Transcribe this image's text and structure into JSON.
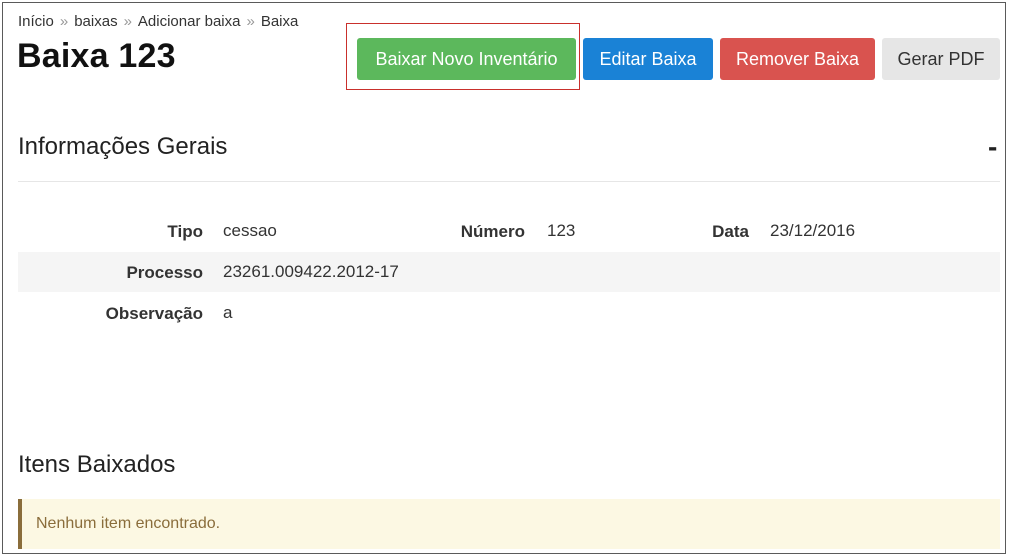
{
  "breadcrumb": {
    "items": [
      "Início",
      "baixas",
      "Adicionar baixa",
      "Baixa"
    ],
    "separator": "»"
  },
  "page": {
    "title": "Baixa 123"
  },
  "actions": {
    "new_inventory": "Baixar Novo Inventário",
    "edit": "Editar Baixa",
    "remove": "Remover Baixa",
    "pdf": "Gerar PDF"
  },
  "general_info": {
    "title": "Informações Gerais",
    "toggle": "-",
    "fields": {
      "tipo": {
        "label": "Tipo",
        "value": "cessao"
      },
      "numero": {
        "label": "Número",
        "value": "123"
      },
      "data": {
        "label": "Data",
        "value": "23/12/2016"
      },
      "processo": {
        "label": "Processo",
        "value": "23261.009422.2012-17"
      },
      "observacao": {
        "label": "Observação",
        "value": "a"
      }
    }
  },
  "items_section": {
    "title": "Itens Baixados",
    "empty_message": "Nenhum item encontrado."
  },
  "colors": {
    "success": "#5cb85c",
    "primary": "#1a82d6",
    "danger": "#d9534f",
    "default": "#e6e6e6",
    "highlight": "#c9302c",
    "warning_bg": "#fcf8e3",
    "warning_text": "#8a6d3b"
  }
}
